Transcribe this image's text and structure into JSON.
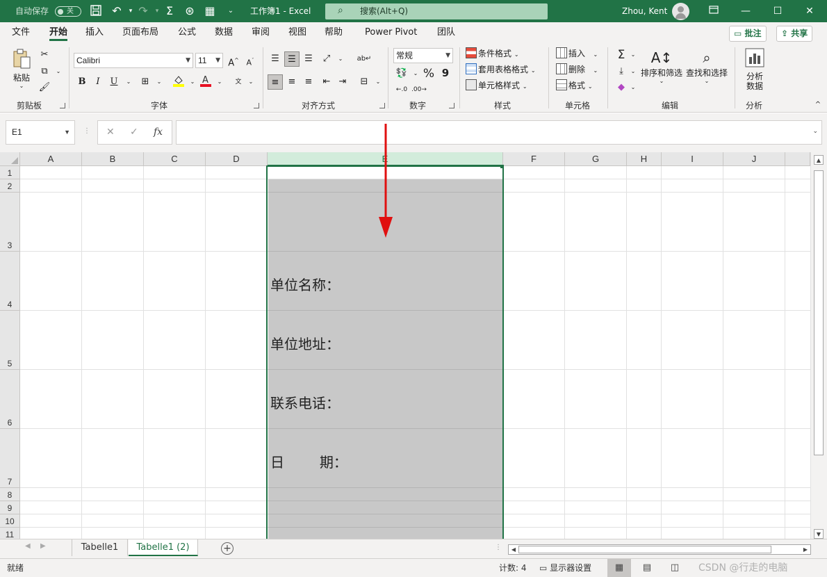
{
  "titlebar": {
    "autosave_label": "自动保存",
    "autosave_state": "关",
    "document_title": "工作簿1  -  Excel",
    "search_placeholder": "搜索(Alt+Q)",
    "user_name": "Zhou, Kent",
    "accent_color": "#217346"
  },
  "ribbon_tabs": [
    "文件",
    "开始",
    "插入",
    "页面布局",
    "公式",
    "数据",
    "审阅",
    "视图",
    "帮助",
    "Power Pivot",
    "团队"
  ],
  "active_tab": "开始",
  "ribbon_buttons": {
    "comments": "批注",
    "share": "共享"
  },
  "ribbon": {
    "clipboard": {
      "label": "剪贴板",
      "paste": "粘贴"
    },
    "font": {
      "label": "字体",
      "name": "Calibri",
      "size": "11",
      "bold": "B",
      "italic": "I",
      "underline": "U",
      "grow": "A",
      "shrink": "A"
    },
    "alignment": {
      "label": "对齐方式"
    },
    "number": {
      "label": "数字",
      "format": "常规",
      "percent": "%",
      "comma": "9"
    },
    "styles": {
      "label": "样式",
      "conditional": "条件格式",
      "table": "套用表格格式",
      "cell": "单元格样式"
    },
    "cells": {
      "label": "单元格",
      "insert": "插入",
      "delete": "删除",
      "format": "格式"
    },
    "editing": {
      "label": "编辑",
      "sort": "排序和筛选",
      "find": "查找和选择"
    },
    "analysis": {
      "label": "分析",
      "analyze_line1": "分析",
      "analyze_line2": "数据"
    }
  },
  "formula_bar": {
    "name_box": "E1",
    "formula": "",
    "fx": "fx"
  },
  "columns": [
    "A",
    "B",
    "C",
    "D",
    "E",
    "F",
    "G",
    "H",
    "I",
    "J"
  ],
  "rows": [
    "1",
    "2",
    "3",
    "4",
    "5",
    "6",
    "7",
    "8",
    "9",
    "10",
    "11"
  ],
  "cells": {
    "E4": "单位名称：",
    "E5": "单位地址：",
    "E6": "联系电话：",
    "E7": "日        期："
  },
  "sheets": [
    "Tabelle1",
    "Tabelle1 (2)"
  ],
  "active_sheet": "Tabelle1 (2)",
  "statusbar": {
    "ready": "就绪",
    "count": "计数: 4",
    "display_settings": "显示器设置",
    "watermark": "CSDN @行走的电脑"
  }
}
